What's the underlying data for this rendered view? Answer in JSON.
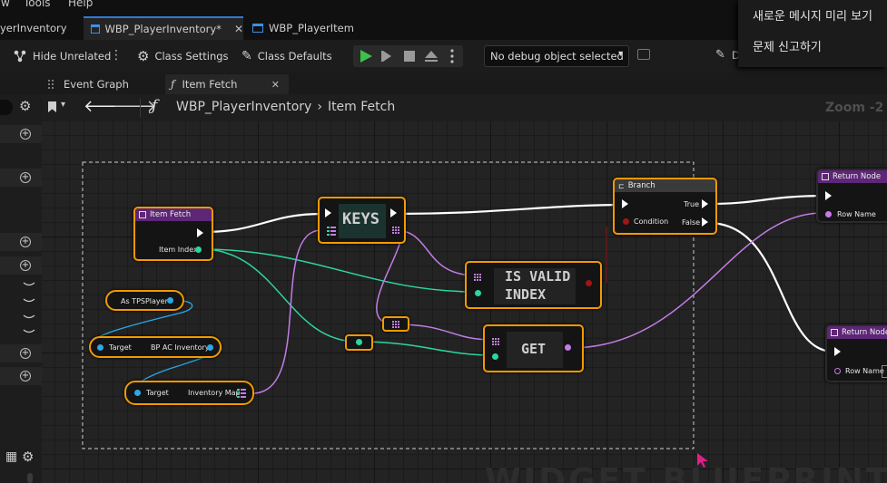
{
  "menu": {
    "items": [
      "w",
      "Tools",
      "Help"
    ]
  },
  "tabs": [
    {
      "label": "yerInventory"
    },
    {
      "label": "WBP_PlayerInventory*",
      "icon": "blueprint-icon"
    },
    {
      "label": "WBP_PlayerItem",
      "icon": "blueprint-icon"
    }
  ],
  "toolbar": {
    "hide_unrelated": "Hide Unrelated",
    "class_settings": "Class Settings",
    "class_defaults": "Class Defaults",
    "debug_select": "No debug object selected",
    "truncated": "D"
  },
  "graph_tabs": [
    {
      "label": "Event Graph"
    },
    {
      "label": "Item Fetch",
      "icon": "function-icon"
    }
  ],
  "breadcrumb": {
    "root": "WBP_PlayerInventory",
    "leaf": "Item Fetch",
    "zoom": "Zoom -2"
  },
  "context_menu": {
    "items": [
      "새로운 메시지 미리 보기",
      "문제 신고하기"
    ]
  },
  "nodes": {
    "item_fetch": {
      "title": "Item Fetch",
      "pin": "Item Index"
    },
    "as_tps": {
      "label": "As TPSPlayer"
    },
    "bp_ac": {
      "target": "Target",
      "label": "BP AC Inventory"
    },
    "inv_map": {
      "target": "Target",
      "label": "Inventory Map"
    },
    "keys": {
      "label": "KEYS"
    },
    "is_valid": {
      "line1": "IS VALID",
      "line2": "INDEX"
    },
    "get": {
      "label": "GET"
    },
    "branch": {
      "title": "Branch",
      "condition": "Condition",
      "true_label": "True",
      "false_label": "False"
    },
    "return1": {
      "title": "Return Node",
      "pin": "Row Name"
    },
    "return2": {
      "title": "Return Node",
      "pin": "Row Name"
    }
  },
  "watermark": "WIDGET BLUEPRINT",
  "colors": {
    "accent": "#2f7bd8",
    "selected_outline": "#f39a00",
    "exec_wire": "#ffffff",
    "int_wire": "#2bd6a1",
    "struct_wire": "#c37ce6",
    "object_wire": "#2aa8e8",
    "play": "#3cc24a"
  }
}
